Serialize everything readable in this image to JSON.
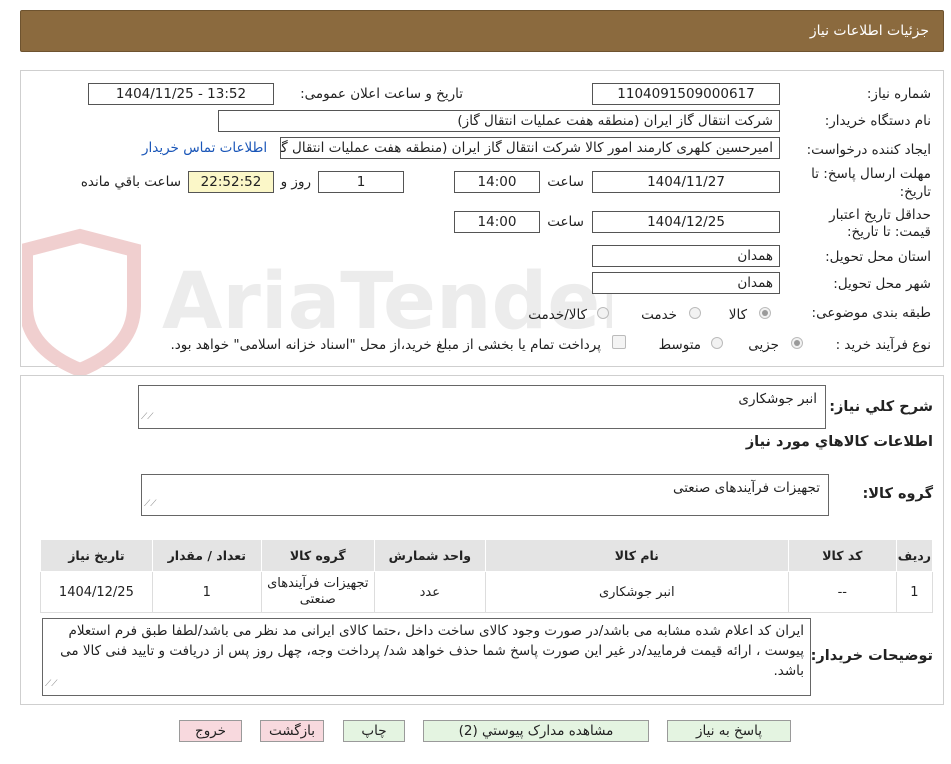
{
  "header": {
    "title": "جزئیات اطلاعات نیاز"
  },
  "fields": {
    "need_number_label": "شماره نیاز:",
    "need_number": "1104091509000617",
    "announce_label": "تاریخ و ساعت اعلان عمومی:",
    "announce_value": "1404/11/25 - 13:52",
    "buyer_label": "نام دستگاه خریدار:",
    "buyer_value": "شرکت انتقال گاز ایران (منطقه هفت عملیات انتقال گاز)",
    "creator_label": "ایجاد کننده درخواست:",
    "creator_value": "امیرحسین کلهری کارمند امور کالا شرکت انتقال گاز ایران (منطقه هفت عملیات انتقال گاز)",
    "contact_link": "اطلاعات تماس خریدار",
    "deadline_label_1": "مهلت ارسال پاسخ: تا",
    "deadline_label_2": "تاریخ:",
    "deadline_date": "1404/11/27",
    "time_label": "ساعت",
    "deadline_time": "14:00",
    "days_value": "1",
    "days_label": "روز و",
    "remaining_value": "22:52:52",
    "remaining_label": "ساعت باقي مانده",
    "validity_label_1": "حداقل تاریخ اعتبار",
    "validity_label_2": "قیمت: تا تاریخ:",
    "validity_date": "1404/12/25",
    "validity_time_label": "ساعت",
    "validity_time": "14:00",
    "province_label": "استان محل تحویل:",
    "province_value": "همدان",
    "city_label": "شهر محل تحویل:",
    "city_value": "همدان",
    "category_label": "طبقه بندی موضوعی:",
    "category_options": [
      "کالا",
      "خدمت",
      "کالا/خدمت"
    ],
    "process_label": "نوع فرآیند خرید :",
    "process_options": [
      "جزیی",
      "متوسط"
    ],
    "process_note": "پرداخت تمام یا بخشی از مبلغ خرید،از محل \"اسناد خزانه اسلامی\" خواهد بود."
  },
  "summary": {
    "label": "شرح کلي نياز:",
    "value": "انبر جوشکاری",
    "goods_info_title": "اطلاعات کالاهاي مورد نياز",
    "group_label": "گروه کالا:",
    "group_value": "تجهیزات فرآیندهای صنعتی"
  },
  "table": {
    "headers": [
      "رديف",
      "کد کالا",
      "نام کالا",
      "واحد شمارش",
      "گروه کالا",
      "تعداد / مقدار",
      "تاريخ نياز"
    ],
    "rows": [
      [
        "1",
        "--",
        "انبر جوشکاری",
        "عدد",
        "تجهیزات فرآیندهای صنعتی",
        "1",
        "1404/12/25"
      ]
    ]
  },
  "notes": {
    "label": "توضيحات خريدار:",
    "text": "ایران کد اعلام شده مشابه می باشد/در صورت وجود کالای ساخت داخل ،حتما کالای ایرانی مد نظر می باشد/لطفا طبق فرم استعلام پیوست ، ارائه قیمت فرمایید/در غیر این صورت پاسخ شما حذف خواهد شد/ پرداخت وجه، چهل روز پس از دریافت و تایید فنی کالا می باشد."
  },
  "buttons": {
    "reply": "پاسخ به نياز",
    "attachments": "مشاهده مدارک پيوستي (2)",
    "print": "چاپ",
    "back": "بازگشت",
    "exit": "خروج"
  },
  "watermark": {
    "text": "AriaTender.neT"
  }
}
